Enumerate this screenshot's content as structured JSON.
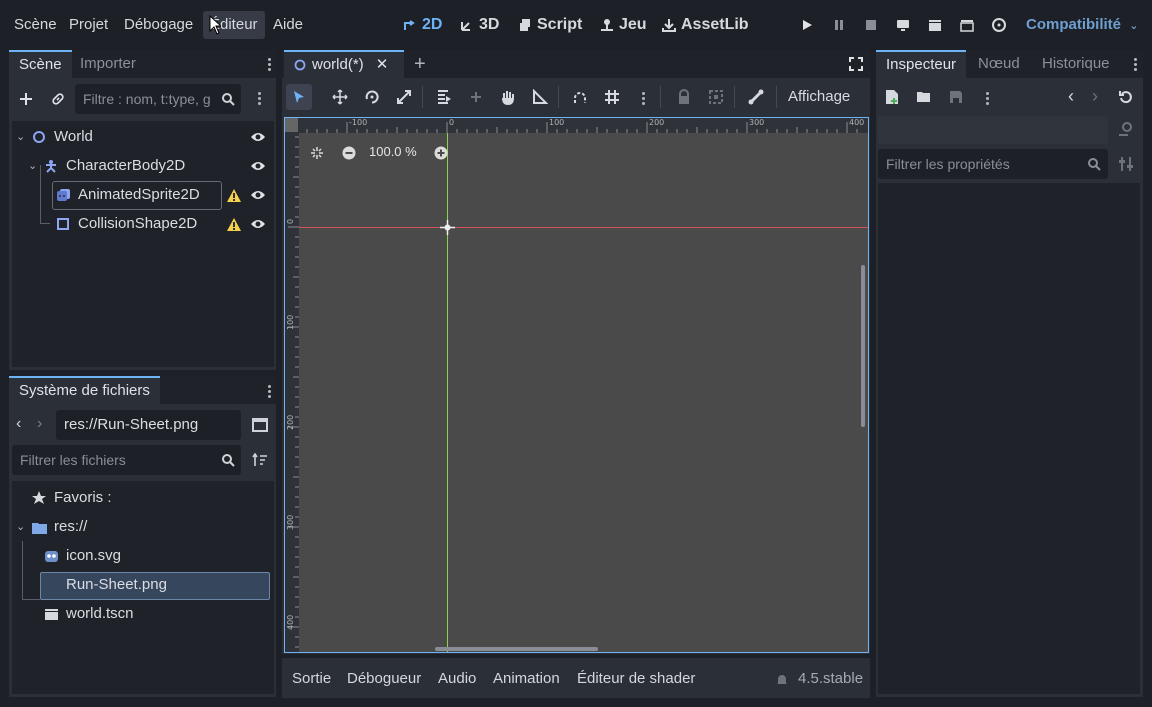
{
  "menubar": {
    "items": [
      "Scène",
      "Projet",
      "Débogage",
      "Éditeur",
      "Aide"
    ],
    "workspaces": [
      "2D",
      "3D",
      "Script",
      "Jeu",
      "AssetLib"
    ],
    "renderer": "Compatibilité"
  },
  "scene_dock": {
    "tabs": [
      "Scène",
      "Importer"
    ],
    "filter_placeholder": "Filtre : nom, t:type, g",
    "tree": [
      {
        "label": "World"
      },
      {
        "label": "CharacterBody2D"
      },
      {
        "label": "AnimatedSprite2D"
      },
      {
        "label": "CollisionShape2D"
      }
    ]
  },
  "filesystem_dock": {
    "title": "Système de fichiers",
    "path": "res://Run-Sheet.png",
    "filter_placeholder": "Filtrer les fichiers",
    "items": [
      {
        "label": "Favoris :"
      },
      {
        "label": "res://"
      },
      {
        "label": "icon.svg"
      },
      {
        "label": "Run-Sheet.png"
      },
      {
        "label": "world.tscn"
      }
    ]
  },
  "editor": {
    "tab_label": "world(*)",
    "view_menu": "Affichage",
    "zoom": "100.0 %",
    "ruler_h_labels": [
      "-100",
      "0",
      "100",
      "200",
      "300",
      "400"
    ],
    "ruler_v_labels": [
      "0",
      "100",
      "200",
      "300",
      "400"
    ]
  },
  "bottom_panel": {
    "tabs": [
      "Sortie",
      "Débogueur",
      "Audio",
      "Animation",
      "Éditeur de shader"
    ],
    "version": "4.5.stable"
  },
  "inspector": {
    "tabs": [
      "Inspecteur",
      "Nœud",
      "Historique"
    ],
    "filter_placeholder": "Filtrer les propriétés"
  },
  "colors": {
    "accent": "#6fb3f7",
    "warning": "#f5d14b",
    "x_axis": "#e0525c",
    "y_axis": "#8fd14f"
  }
}
